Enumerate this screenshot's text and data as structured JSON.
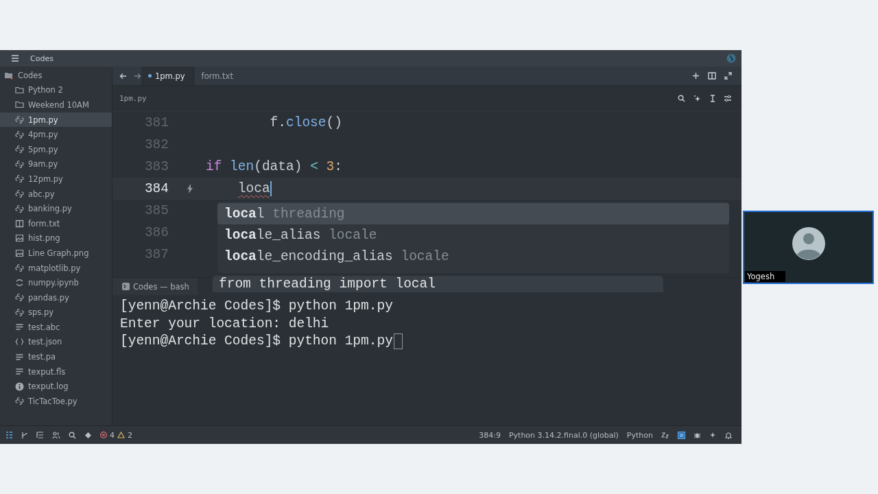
{
  "window": {
    "title": "Codes"
  },
  "sidebar": {
    "root": "Codes",
    "items": [
      {
        "label": "Python 2",
        "kind": "folder",
        "selected": false
      },
      {
        "label": "Weekend 10AM",
        "kind": "folder",
        "selected": false
      },
      {
        "label": "1pm.py",
        "kind": "python",
        "selected": true
      },
      {
        "label": "4pm.py",
        "kind": "python",
        "selected": false
      },
      {
        "label": "5pm.py",
        "kind": "python",
        "selected": false
      },
      {
        "label": "9am.py",
        "kind": "python",
        "selected": false
      },
      {
        "label": "12pm.py",
        "kind": "python",
        "selected": false
      },
      {
        "label": "abc.py",
        "kind": "python",
        "selected": false
      },
      {
        "label": "banking.py",
        "kind": "python",
        "selected": false
      },
      {
        "label": "form.txt",
        "kind": "book",
        "selected": false
      },
      {
        "label": "hist.png",
        "kind": "image",
        "selected": false
      },
      {
        "label": "Line Graph.png",
        "kind": "image",
        "selected": false
      },
      {
        "label": "matplotlib.py",
        "kind": "python",
        "selected": false
      },
      {
        "label": "numpy.ipynb",
        "kind": "notebook",
        "selected": false
      },
      {
        "label": "pandas.py",
        "kind": "python",
        "selected": false
      },
      {
        "label": "sps.py",
        "kind": "python",
        "selected": false
      },
      {
        "label": "test.abc",
        "kind": "text",
        "selected": false
      },
      {
        "label": "test.json",
        "kind": "json",
        "selected": false
      },
      {
        "label": "test.pa",
        "kind": "text",
        "selected": false
      },
      {
        "label": "texput.fls",
        "kind": "text",
        "selected": false
      },
      {
        "label": "texput.log",
        "kind": "info",
        "selected": false
      },
      {
        "label": "TicTacToe.py",
        "kind": "python",
        "selected": false
      }
    ]
  },
  "tabs": [
    {
      "label": "1pm.py",
      "selected": true,
      "modified": true
    },
    {
      "label": "form.txt",
      "selected": false,
      "modified": false
    }
  ],
  "breadcrumb": "1pm.py",
  "editor": {
    "lines": [
      {
        "number": "381",
        "active": false,
        "nested": true,
        "tokens": [
          {
            "text": "    f.",
            "kind": "plain"
          },
          {
            "text": "close",
            "kind": "func"
          },
          {
            "text": "()",
            "kind": "plain"
          }
        ]
      },
      {
        "number": "382",
        "active": false
      },
      {
        "number": "383",
        "active": false,
        "nested": false,
        "tokens": [
          {
            "text": "if ",
            "kind": "keyword"
          },
          {
            "text": "len",
            "kind": "func"
          },
          {
            "text": "(data) ",
            "kind": "plain"
          },
          {
            "text": "< ",
            "kind": "op"
          },
          {
            "text": "3",
            "kind": "number"
          },
          {
            "text": ":",
            "kind": "plain"
          }
        ]
      },
      {
        "number": "384",
        "active": true,
        "nested": true,
        "tokens": [
          {
            "text": "loca",
            "kind": "error"
          }
        ]
      },
      {
        "number": "385",
        "active": false
      },
      {
        "number": "386",
        "active": false
      },
      {
        "number": "387",
        "active": false
      }
    ]
  },
  "completion": {
    "items": [
      {
        "match": "loca",
        "rest": "l",
        "source": "threading",
        "selected": true
      },
      {
        "match": "loca",
        "rest": "le_alias",
        "source": "locale",
        "selected": false
      },
      {
        "match": "loca",
        "rest": "le_encoding_alias",
        "source": "locale",
        "selected": false
      }
    ],
    "detail": "from threading import local"
  },
  "terminal": {
    "title": "Codes — bash",
    "lines": [
      "[yenn@Archie Codes]$ python 1pm.py",
      "Enter your location: delhi",
      "[yenn@Archie Codes]$ python 1pm.py"
    ]
  },
  "status_bar": {
    "errors": "4",
    "warnings": "2",
    "position": "384:9",
    "interpreter": "Python 3.14.2.final.0 (global)",
    "language": "Python"
  },
  "participant": {
    "name": "Yogesh"
  }
}
